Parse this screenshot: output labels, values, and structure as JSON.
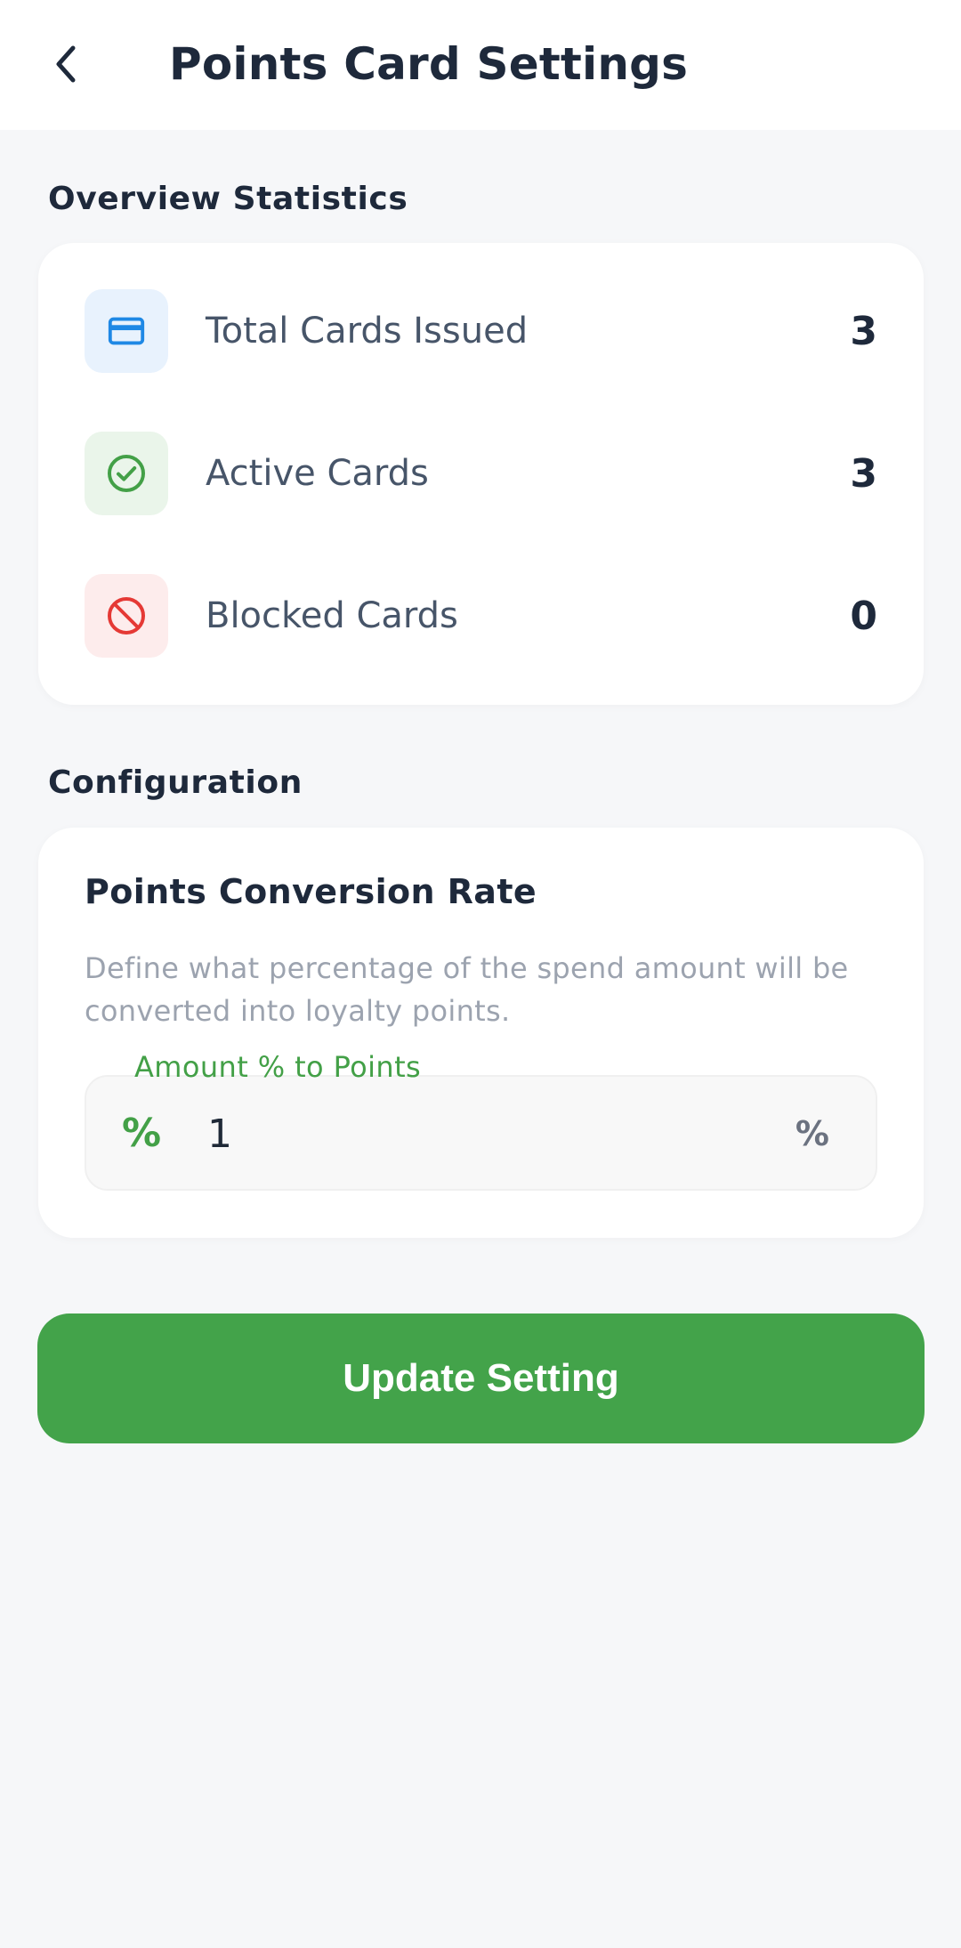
{
  "header": {
    "title": "Points Card Settings",
    "back_icon": "chevron-left-icon"
  },
  "overview": {
    "section_title": "Overview Statistics",
    "stats": [
      {
        "label": "Total Cards Issued",
        "value": "3",
        "icon": "credit-card-icon",
        "icon_color": "#1e88e5",
        "icon_bg": "#e8f2fd"
      },
      {
        "label": "Active Cards",
        "value": "3",
        "icon": "check-circle-icon",
        "icon_color": "#43a047",
        "icon_bg": "#eaf5ea"
      },
      {
        "label": "Blocked Cards",
        "value": "0",
        "icon": "block-icon",
        "icon_color": "#e53935",
        "icon_bg": "#fdecec"
      }
    ]
  },
  "configuration": {
    "section_title": "Configuration",
    "card_title": "Points Conversion Rate",
    "description": "Define what percentage of the spend amount will be converted into loyalty points.",
    "field": {
      "label": "Amount % to Points",
      "prefix": "%",
      "value": "1",
      "suffix": "%"
    }
  },
  "actions": {
    "update_label": "Update Setting"
  },
  "colors": {
    "accent": "#43a34a",
    "background": "#f6f7f9"
  }
}
